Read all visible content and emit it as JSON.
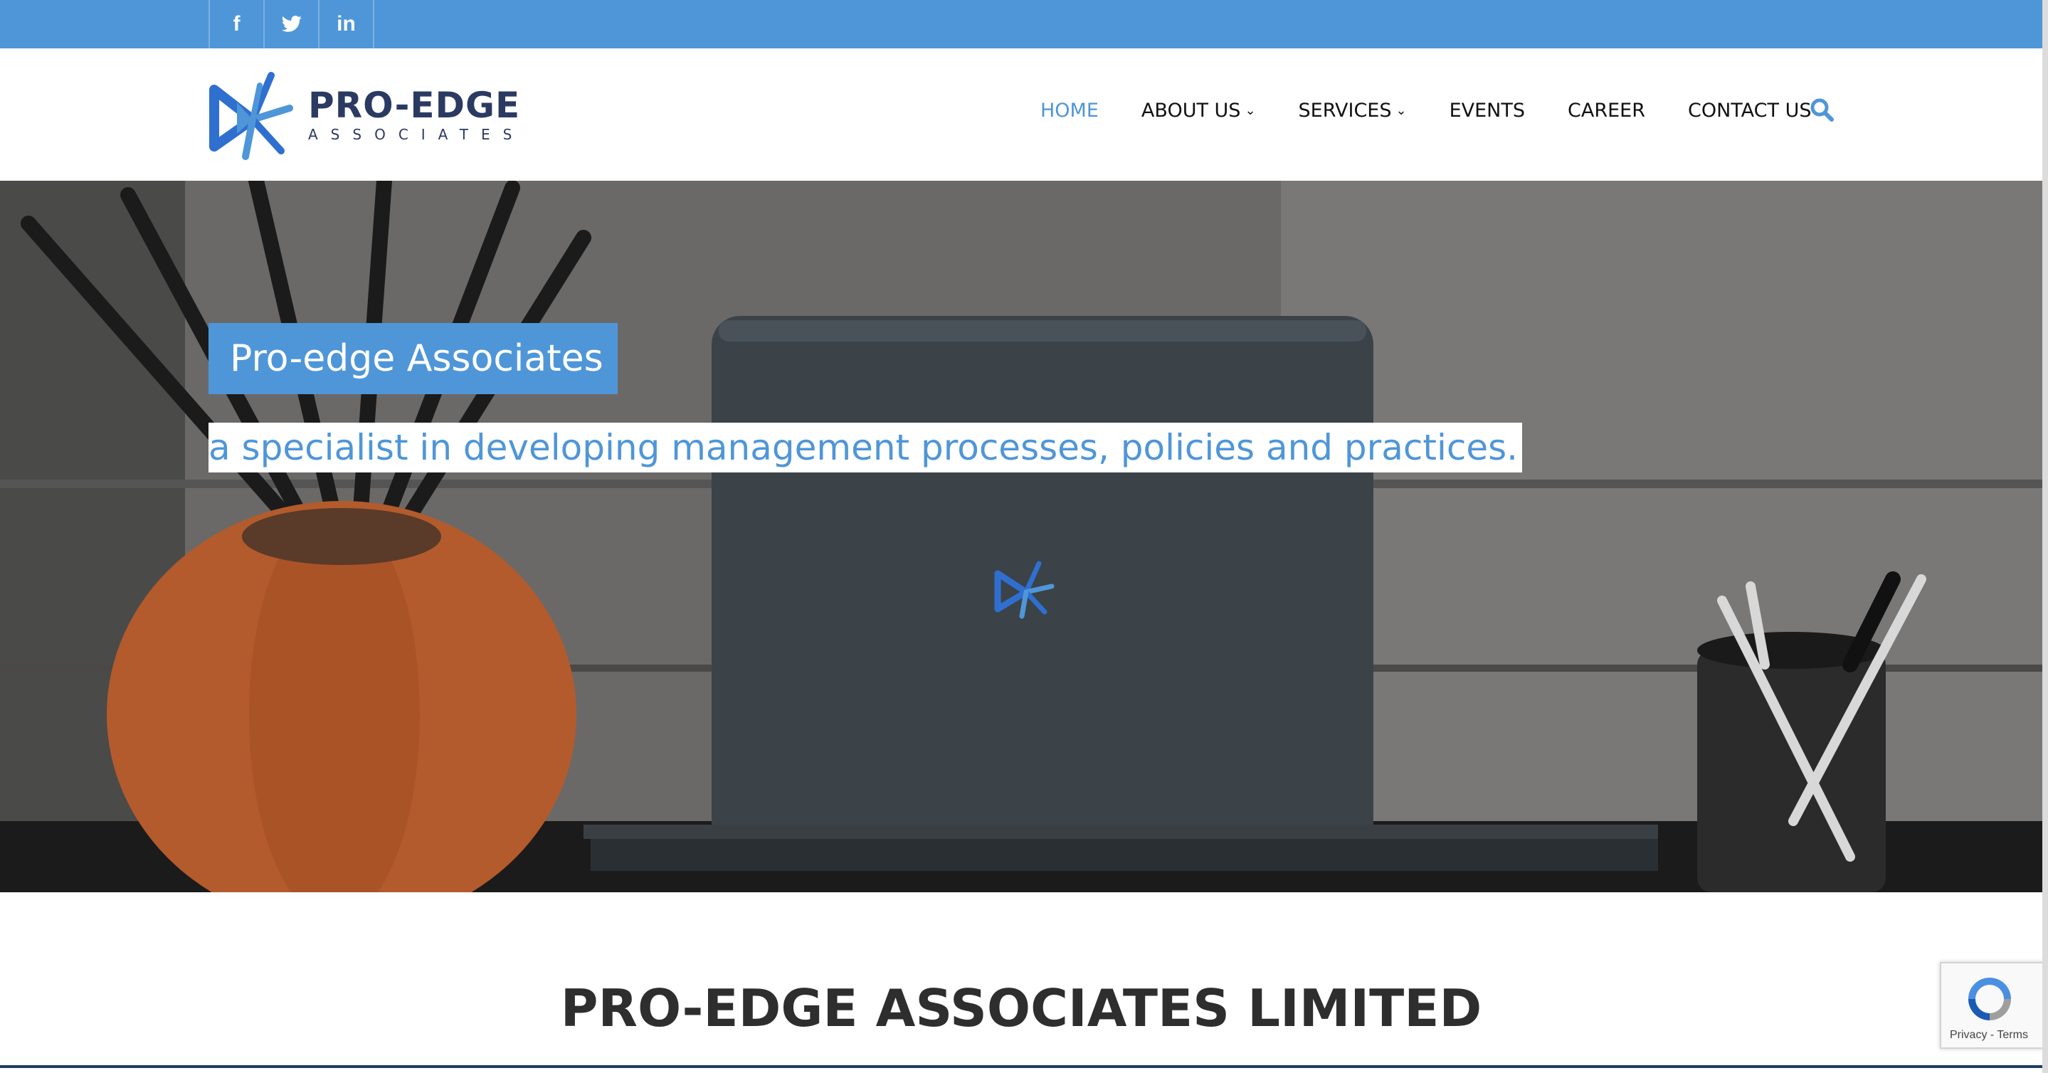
{
  "social": {
    "items": [
      {
        "name": "facebook",
        "glyph": "f"
      },
      {
        "name": "twitter",
        "glyph": ""
      },
      {
        "name": "linkedin",
        "glyph": "in"
      }
    ]
  },
  "logo": {
    "title": "PRO-EDGE",
    "subtitle": "ASSOCIATES"
  },
  "nav": {
    "items": [
      {
        "label": "HOME"
      },
      {
        "label": "ABOUT US"
      },
      {
        "label": "SERVICES"
      },
      {
        "label": "EVENTS"
      },
      {
        "label": "CAREER"
      },
      {
        "label": "CONTACT US"
      }
    ]
  },
  "hero": {
    "badge": "Pro-edge Associates",
    "tagline": "a specialist in developing management processes, policies and practices."
  },
  "section": {
    "heading": "PRO-EDGE ASSOCIATES LIMITED"
  },
  "recaptcha": {
    "links": "Privacy - Terms"
  },
  "colors": {
    "accent": "#4f96d8",
    "logo_navy": "#2b3a62",
    "text_dark": "#2e2e2e"
  }
}
